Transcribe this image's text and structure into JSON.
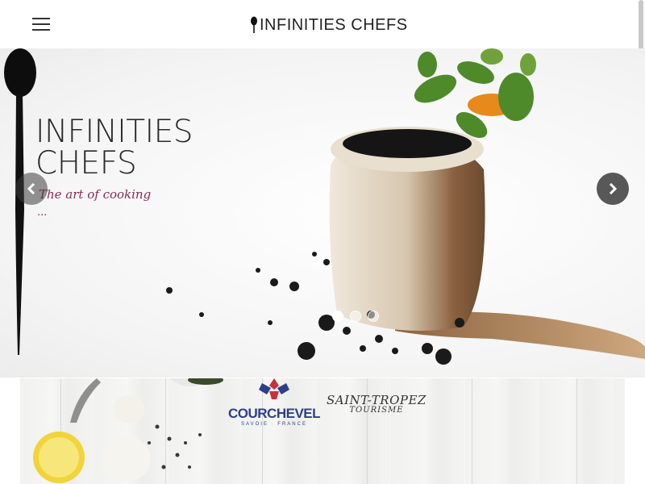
{
  "header": {
    "brand": "INFINITIES CHEFS",
    "menu_icon": "hamburger-menu-icon",
    "brand_icon": "spoon-icon"
  },
  "hero": {
    "title_line1": "INFINITIES",
    "title_line2": "CHEFS",
    "tagline": "The art of cooking",
    "tagline_dots": "...",
    "slides_total": 3,
    "active_slide": 1,
    "prev_icon": "chevron-left-icon",
    "next_icon": "chevron-right-icon"
  },
  "partners": {
    "courchevel": {
      "name": "COURCHEVEL",
      "sub": "SAVOIE · FRANCE"
    },
    "saint_tropez": {
      "name": "SAINT-TROPEZ",
      "sub": "TOURISME"
    }
  },
  "colors": {
    "accent": "#8a2b55",
    "courchevel_blue": "#2d3f8a",
    "courchevel_red": "#c8323c"
  }
}
